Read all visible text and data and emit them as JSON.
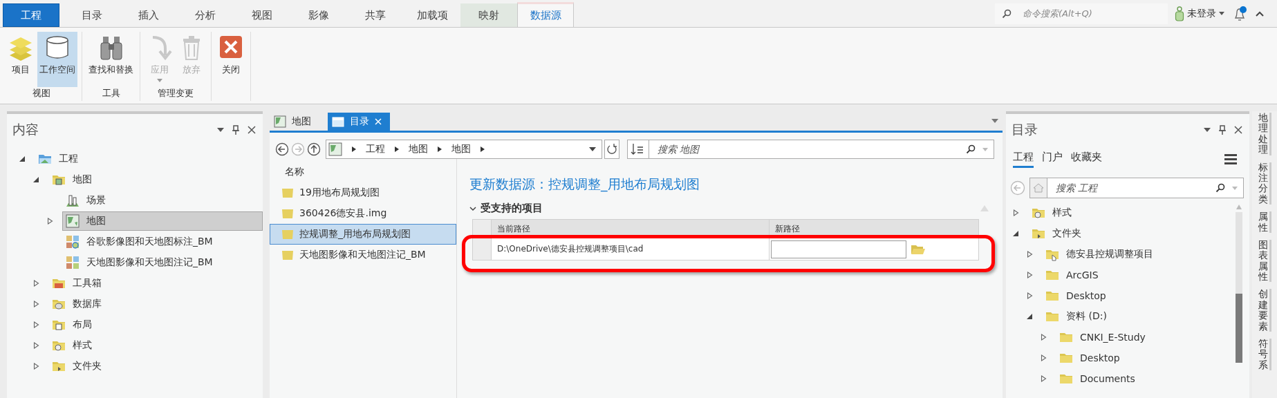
{
  "app_tabs": [
    {
      "label": "工程",
      "kind": "backstage",
      "selected": false
    },
    {
      "label": "目录",
      "kind": "tab",
      "selected": false
    },
    {
      "label": "插入",
      "kind": "tab",
      "selected": false
    },
    {
      "label": "分析",
      "kind": "tab",
      "selected": false
    },
    {
      "label": "视图",
      "kind": "tab",
      "selected": false
    },
    {
      "label": "影像",
      "kind": "tab",
      "selected": false
    },
    {
      "label": "共享",
      "kind": "tab",
      "selected": false
    },
    {
      "label": "加载项",
      "kind": "tab",
      "selected": false
    },
    {
      "label": "映射",
      "kind": "context",
      "selected": false
    },
    {
      "label": "数据源",
      "kind": "tab",
      "selected": true
    }
  ],
  "command_search": {
    "placeholder": "命令搜索(Alt+Q)"
  },
  "user": {
    "label": "未登录"
  },
  "notifications": {
    "unread": true
  },
  "ribbon": {
    "groups": [
      {
        "label": "视图",
        "buttons": [
          {
            "label": "项目",
            "kind": "layers",
            "selected": false,
            "disabled": false,
            "dropdown": false
          },
          {
            "label": "工作空间",
            "kind": "cylinder",
            "selected": true,
            "disabled": false,
            "dropdown": false
          }
        ]
      },
      {
        "label": "工具",
        "buttons": [
          {
            "label": "查找和替换",
            "kind": "binoculars",
            "selected": false,
            "disabled": false,
            "dropdown": false
          }
        ]
      },
      {
        "label": "管理变更",
        "buttons": [
          {
            "label": "应用",
            "kind": "apply",
            "selected": false,
            "disabled": true,
            "dropdown": true
          },
          {
            "label": "放弃",
            "kind": "trash",
            "selected": false,
            "disabled": true,
            "dropdown": false
          }
        ]
      },
      {
        "buttons": [
          {
            "label": "关闭",
            "kind": "close",
            "selected": false,
            "disabled": false,
            "dropdown": false
          }
        ]
      }
    ]
  },
  "contents": {
    "title": "内容",
    "tree": [
      {
        "label": "工程",
        "kind": "project-folder",
        "expanded": true,
        "selected": false,
        "children": [
          {
            "label": "地图",
            "kind": "map-folder",
            "expanded": true,
            "selected": false,
            "children": [
              {
                "label": "场景",
                "kind": "scene",
                "selected": false
              },
              {
                "label": "地图",
                "kind": "map",
                "expanded": false,
                "selected": true
              },
              {
                "label": "谷歌影像图和天地图标注_BM",
                "kind": "basemap-link",
                "selected": false
              },
              {
                "label": "天地图影像和天地图注记_BM",
                "kind": "basemap",
                "selected": false
              }
            ]
          },
          {
            "label": "工具箱",
            "kind": "toolbox-folder",
            "expanded": false,
            "selected": false
          },
          {
            "label": "数据库",
            "kind": "database-folder",
            "expanded": false,
            "selected": false
          },
          {
            "label": "布局",
            "kind": "layout-folder",
            "expanded": false,
            "selected": false
          },
          {
            "label": "样式",
            "kind": "style-folder",
            "expanded": false,
            "selected": false
          },
          {
            "label": "文件夹",
            "kind": "folder-folder",
            "expanded": false,
            "selected": false
          }
        ]
      }
    ]
  },
  "view_tabs": [
    {
      "label": "地图",
      "kind": "map",
      "selected": false,
      "closable": false
    },
    {
      "label": "目录",
      "kind": "catalog",
      "selected": true,
      "closable": true
    }
  ],
  "catalog_view": {
    "breadcrumb": [
      "工程",
      "地图",
      "地图"
    ],
    "search": {
      "placeholder": "搜索 地图"
    },
    "list_header": "名称",
    "items": [
      {
        "label": "19用地布局规划图",
        "selected": false
      },
      {
        "label": "360426德安县.img",
        "selected": false
      },
      {
        "label": "控规调整_用地布局规划图",
        "selected": true
      },
      {
        "label": "天地图影像和天地图注记_BM",
        "selected": false
      }
    ],
    "detail": {
      "title": "更新数据源：控规调整_用地布局规划图",
      "section": {
        "label": "受支持的项目",
        "expanded": true
      },
      "columns": [
        "当前路径",
        "新路径"
      ],
      "rows": [
        {
          "current_path": "D:\\OneDrive\\德安县控规调整项目\\cad"
        }
      ]
    }
  },
  "catalog_pane": {
    "title": "目录",
    "tabs": [
      {
        "label": "工程",
        "selected": true
      },
      {
        "label": "门户",
        "selected": false
      },
      {
        "label": "收藏夹",
        "selected": false
      }
    ],
    "search": {
      "placeholder": "搜索 工程"
    },
    "tree": [
      {
        "label": "样式",
        "kind": "style-folder",
        "expanded": false,
        "selected": false
      },
      {
        "label": "文件夹",
        "kind": "folder-folder",
        "expanded": true,
        "selected": false,
        "children": [
          {
            "label": "德安县控规调整项目",
            "kind": "home-folder",
            "expanded": false,
            "selected": false
          },
          {
            "label": "ArcGIS",
            "kind": "folder",
            "expanded": false,
            "selected": false
          },
          {
            "label": "Desktop",
            "kind": "folder",
            "expanded": false,
            "selected": false
          },
          {
            "label": "资料 (D:)",
            "kind": "folder",
            "expanded": true,
            "selected": false,
            "children": [
              {
                "label": "CNKI_E-Study",
                "kind": "folder",
                "expanded": false,
                "selected": false
              },
              {
                "label": "Desktop",
                "kind": "folder",
                "expanded": false,
                "selected": false
              },
              {
                "label": "Documents",
                "kind": "folder",
                "expanded": false,
                "selected": false
              }
            ]
          }
        ]
      }
    ]
  },
  "side_tabs": [
    "地理处理",
    "标注分类",
    "属性",
    "图表属性",
    "创建要素",
    "符号系"
  ]
}
